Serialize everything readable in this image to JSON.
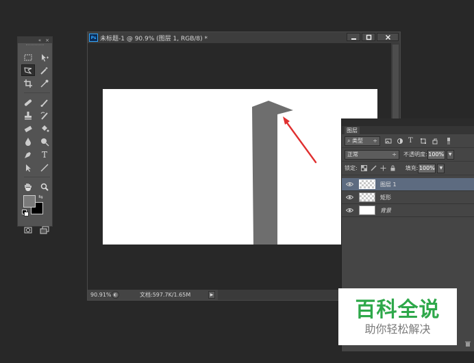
{
  "tools_panel": {
    "collapse_glyph": "«",
    "close_glyph": "×",
    "tools": [
      "marquee-tool",
      "move-tool",
      "lasso-tool",
      "quick-select-tool",
      "crop-tool",
      "eyedropper-tool",
      "healing-brush-tool",
      "brush-tool",
      "clone-stamp-tool",
      "history-brush-tool",
      "eraser-tool",
      "paint-bucket-tool",
      "blur-tool",
      "dodge-tool",
      "pen-tool",
      "type-tool",
      "path-select-tool",
      "line-tool",
      "hand-tool",
      "zoom-tool"
    ],
    "active_tool": "lasso-tool",
    "foreground_color": "#7a7a7a",
    "background_color": "#000000",
    "type_tool_glyph": "T"
  },
  "document": {
    "app_badge": "Ps",
    "title": "未标题-1 @ 90.9% (图层 1, RGB/8) *",
    "status_zoom": "90.91%",
    "status_info": "文档:597.7K/1.65M",
    "canvas_background": "#ffffff",
    "shape_color": "#6e6e6e",
    "annotation_arrow_color": "#e03030"
  },
  "layers_panel": {
    "tab_label": "图层",
    "filter_kind": "类型",
    "blend_mode": "正常",
    "opacity_label": "不透明度:",
    "opacity_value": "100%",
    "lock_label": "锁定:",
    "fill_label": "填充:",
    "fill_value": "100%",
    "type_glyph": "T",
    "layers": [
      {
        "name": "图层 1",
        "selected": true
      },
      {
        "name": "矩形",
        "selected": false
      },
      {
        "name": "背景",
        "selected": false
      }
    ]
  },
  "watermark": {
    "title": "百科全说",
    "subtitle": "助你轻松解决",
    "accent_color": "#2ea84a"
  }
}
